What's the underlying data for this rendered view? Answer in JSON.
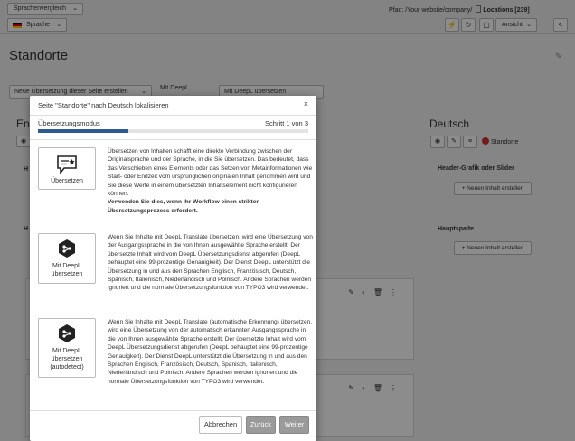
{
  "topbar": {
    "language_compare": "Sprachenvergleich",
    "language_select": "Sprache",
    "path_label": "Pfad: /Your website/company/",
    "page_name": "Locations [239]",
    "view_label": "Ansicht"
  },
  "page": {
    "title": "Standorte",
    "new_translation_select": "Neue Übersetzung dieser Seite erstellen",
    "deepl_label": "Mit DeepL",
    "deepl_select": "Mit DeepL übersetzen"
  },
  "left_column": {
    "title": "En",
    "heading_1": "H",
    "heading_2": "H"
  },
  "right_column": {
    "title": "Deutsch",
    "page_label": "Standorte",
    "section_1": "Header-Grafik oder Slider",
    "section_2": "Hauptspalte",
    "new_content_1": "+ Neuen Inhalt erstellen",
    "new_content_2": "+ Neuen Inhalt erstellen"
  },
  "modal": {
    "title": "Seite \"Standorte\" nach Deutsch lokalisieren",
    "close_glyph": "×",
    "step_label": "Übersetzungsmodus",
    "step_count": "Schritt 1 von 3",
    "progress": 0.3333,
    "options": [
      {
        "label": "Übersetzen",
        "desc": "Übersetzen von Inhalten schafft eine direkte Verbindung zwischen der Originalsprache und der Sprache, in die Sie übersetzen. Das bedeutet, dass das Verschieben eines Elements oder das Setzen von Metainformationen wie Start- oder Endzeit vom ursprünglichen originalen Inhalt genommen wird und Sie diese Werte in einem übersetzten Inhaltselement nicht konfigurieren können.",
        "desc_bold": "Verwenden Sie dies, wenn Ihr Workflow einen strikten Übersetzungsprozess erfordert."
      },
      {
        "label_line1": "Mit DeepL",
        "label_line2": "übersetzen",
        "desc": "Wenn Sie Inhalte mit DeepL Translate übersetzen, wird eine Übersetzung von der Ausgangssprache in die von Ihnen ausgewählte Sprache erstellt. Der übersetzte Inhalt wird vom DeepL Übersetzungsdienst abgerufen (DeepL behauptet eine 99-prozentige Genauigkeit). Der Dienst DeepL unterstützt die Übersetzung in und aus den Sprachen Englisch, Französisch, Deutsch, Spanisch, Italienisch, Niederländisch und Polnisch. Andere Sprachen werden ignoriert und die normale Übersetzungsfunktion von TYPO3 wird verwendet."
      },
      {
        "label_line1": "Mit DeepL",
        "label_line2": "übersetzen",
        "label_line3": "(autodetect)",
        "desc": "Wenn Sie Inhalte mit DeepL Translate (automatische Erkennung) übersetzen, wird eine Übersetzung von der automatisch erkannten Ausgangssprache in die von Ihnen ausgewählte Sprache erstellt. Der übersetzte Inhalt wird vom DeepL Übersetzungsdienst abgerufen (DeepL behauptet eine 99-prozentige Genauigkeit). Der Dienst DeepL unterstützt die Übersetzung in und aus den Sprachen Englisch, Französisch, Deutsch, Spanisch, Italienisch, Niederländisch und Polnisch. Andere Sprachen werden ignoriert und die normale Übersetzungsfunktion von TYPO3 wird verwendet."
      }
    ],
    "buttons": {
      "cancel": "Abbrechen",
      "back": "Zurück",
      "next": "Weiter"
    }
  }
}
